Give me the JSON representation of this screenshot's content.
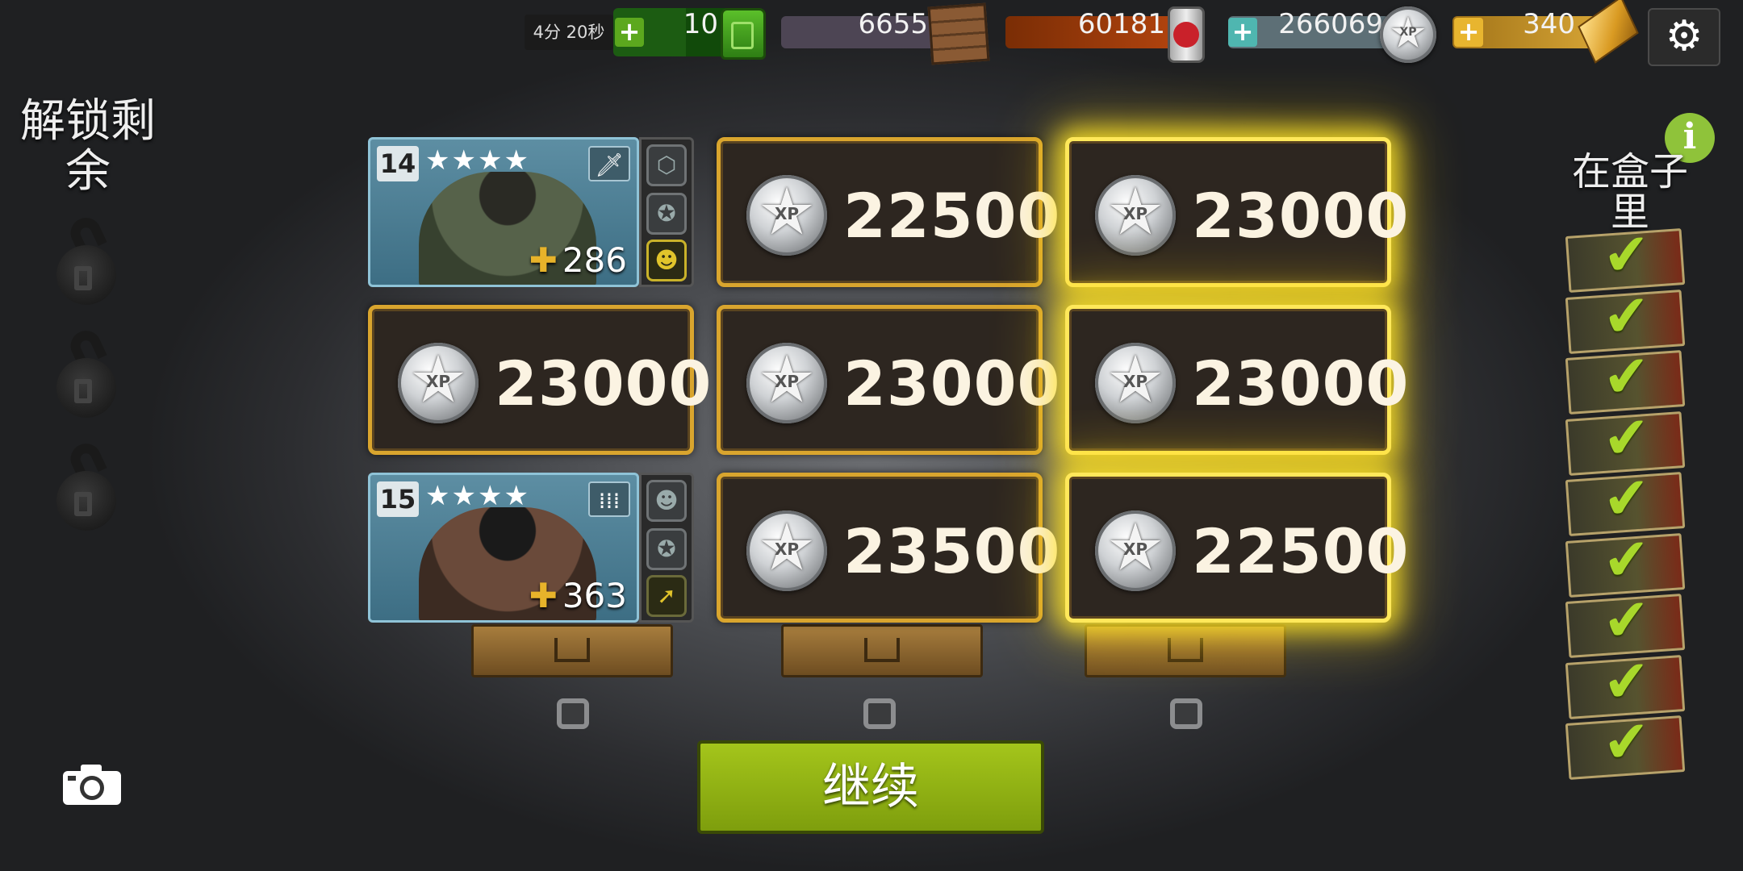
{
  "topbar": {
    "timer": "4分 20秒",
    "fuel": "10",
    "supplies": "6655",
    "food": "60181",
    "xp": "266069",
    "gold": "340",
    "plus_glyph": "+"
  },
  "left_panel": {
    "title": "解锁剩余",
    "locks": [
      "lock-1",
      "lock-2",
      "lock-3"
    ]
  },
  "rewards": {
    "item_1": {
      "level": "14",
      "stars": "★★★★",
      "power": "286"
    },
    "item_2": {
      "level": "15",
      "stars": "★★★★",
      "power": "363"
    },
    "xp_label": "XP",
    "amounts": {
      "r1c2": "22500",
      "r1c3": "23000",
      "r2c1": "23000",
      "r2c2": "23000",
      "r2c3": "23000",
      "r3c2": "23500",
      "r3c3": "22500"
    }
  },
  "continue_label": "继续",
  "right_panel": {
    "title": "在盒子里",
    "info_glyph": "i",
    "checked_count": 9
  },
  "colors": {
    "card_border": "#d9a52e",
    "glow": "#ffe85a",
    "continue_green": "#8fb114",
    "check_green": "#a8d82b"
  },
  "icons": [
    "jerry-can-icon",
    "crate-icon",
    "food-can-icon",
    "xp-medal-icon",
    "gold-bar-icon",
    "gear-icon",
    "lock-icon",
    "camera-icon",
    "info-icon",
    "checkmark-icon"
  ]
}
